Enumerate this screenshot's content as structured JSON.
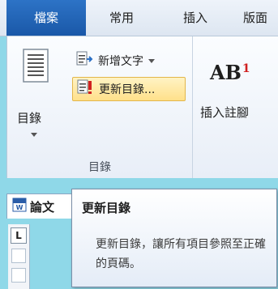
{
  "tabs": {
    "file": "檔案",
    "home": "常用",
    "insert": "插入",
    "layout": "版面"
  },
  "toc_group": {
    "toc_button": "目錄",
    "add_text": "新增文字",
    "update_toc": "更新目錄...",
    "group_label": "目錄"
  },
  "footnote_group": {
    "insert_footnote": "插入註腳",
    "glyph": "AB",
    "glyph_sup": "1"
  },
  "document": {
    "tab_title": "論文",
    "ruler_button": "L"
  },
  "tooltip": {
    "title": "更新目錄",
    "body": "更新目錄，讓所有項目參照至正確的頁碼。"
  },
  "colors": {
    "file_tab": "#1a58a8",
    "highlight": "#ffe08a",
    "background": "#8fd8e8"
  }
}
